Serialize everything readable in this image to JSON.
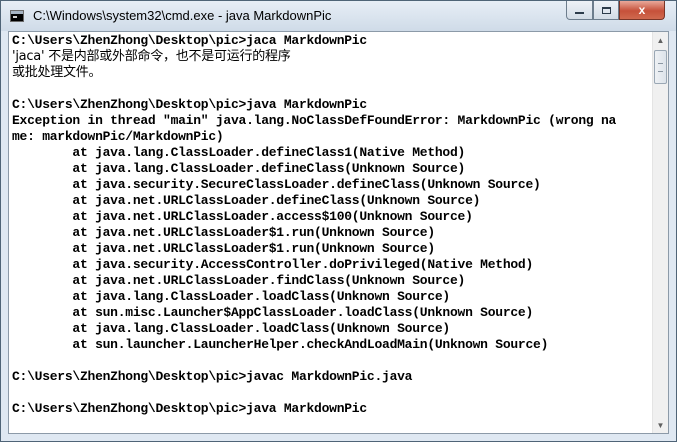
{
  "window": {
    "title": "C:\\Windows\\system32\\cmd.exe - java  MarkdownPic",
    "controls": {
      "minimize": "minimize",
      "maximize": "maximize",
      "close": "x"
    }
  },
  "console": {
    "lines": [
      "C:\\Users\\ZhenZhong\\Desktop\\pic>jaca MarkdownPic",
      "'jaca' 不是内部或外部命令，也不是可运行的程序",
      "或批处理文件。",
      "",
      "C:\\Users\\ZhenZhong\\Desktop\\pic>java MarkdownPic",
      "Exception in thread \"main\" java.lang.NoClassDefFoundError: MarkdownPic (wrong na",
      "me: markdownPic/MarkdownPic)",
      "        at java.lang.ClassLoader.defineClass1(Native Method)",
      "        at java.lang.ClassLoader.defineClass(Unknown Source)",
      "        at java.security.SecureClassLoader.defineClass(Unknown Source)",
      "        at java.net.URLClassLoader.defineClass(Unknown Source)",
      "        at java.net.URLClassLoader.access$100(Unknown Source)",
      "        at java.net.URLClassLoader$1.run(Unknown Source)",
      "        at java.net.URLClassLoader$1.run(Unknown Source)",
      "        at java.security.AccessController.doPrivileged(Native Method)",
      "        at java.net.URLClassLoader.findClass(Unknown Source)",
      "        at java.lang.ClassLoader.loadClass(Unknown Source)",
      "        at sun.misc.Launcher$AppClassLoader.loadClass(Unknown Source)",
      "        at java.lang.ClassLoader.loadClass(Unknown Source)",
      "        at sun.launcher.LauncherHelper.checkAndLoadMain(Unknown Source)",
      "",
      "C:\\Users\\ZhenZhong\\Desktop\\pic>javac MarkdownPic.java",
      "",
      "C:\\Users\\ZhenZhong\\Desktop\\pic>java MarkdownPic"
    ]
  },
  "icons": {
    "app": "console-app-icon",
    "scroll_up": "scroll-up-arrow-icon",
    "scroll_down": "scroll-down-arrow-icon"
  },
  "colors": {
    "console_background": "#ffffff",
    "console_text": "#000000",
    "close_button": "#c6513a"
  }
}
